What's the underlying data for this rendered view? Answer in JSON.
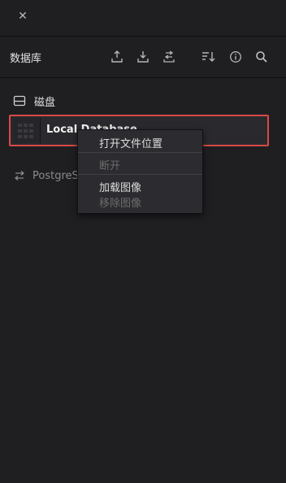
{
  "window": {
    "close_icon": "close-icon"
  },
  "header": {
    "title": "数据库",
    "icons": [
      "upload-icon",
      "download-icon",
      "swap-icon",
      "sort-icon",
      "info-icon",
      "search-icon"
    ]
  },
  "sections": {
    "disk": {
      "label": "磁盘",
      "icon": "disk-icon"
    }
  },
  "databases": [
    {
      "name": "Local Database",
      "selected": true,
      "thumbnail": "database-thumbnail"
    },
    {
      "name": "PostgreS",
      "icon": "connect-arrows-icon"
    }
  ],
  "context_menu": {
    "items": [
      {
        "label": "打开文件位置",
        "enabled": true
      },
      {
        "label": "断开",
        "enabled": false
      },
      {
        "label": "加载图像",
        "enabled": true
      },
      {
        "label": "移除图像",
        "enabled": false
      }
    ]
  },
  "colors": {
    "background": "#1f1f22",
    "selection_border": "#d84a45",
    "menu_background": "#2c2c30"
  }
}
